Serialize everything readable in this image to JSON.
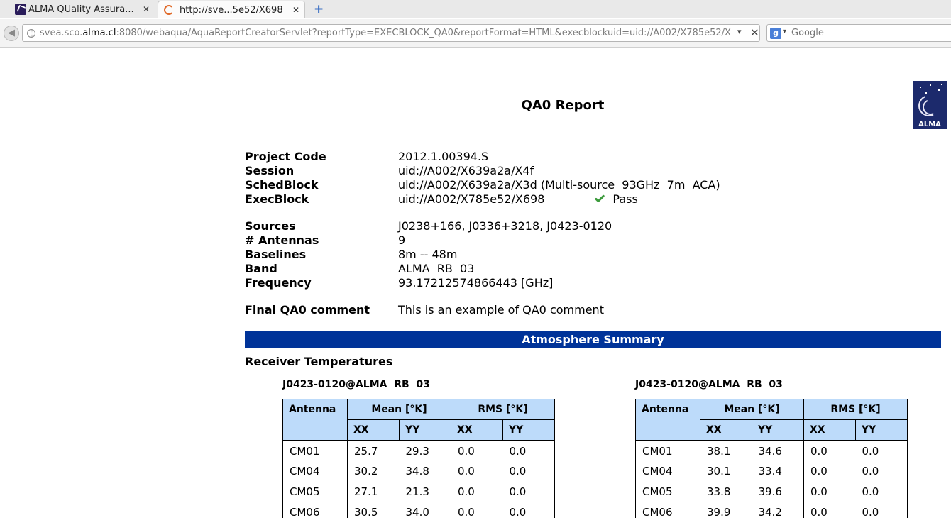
{
  "browser": {
    "tabs": [
      {
        "title": "ALMA QUality Assura...",
        "active": false
      },
      {
        "title": "http://sve...5e52/X698",
        "active": true
      }
    ],
    "new_tab_symbol": "+",
    "url_prefix": "svea.sco.",
    "url_domain": "alma.cl",
    "url_suffix": ":8080/webaqua/AquaReportCreatorServlet?reportType=EXECBLOCK_QA0&reportFormat=HTML&execblockuid=uid://A002/X785e52/X",
    "search_engine_icon": "google-icon",
    "search_placeholder": "Google"
  },
  "report": {
    "title": "QA0 Report",
    "logo_text": "ALMA",
    "fields_primary": [
      {
        "label": "Project Code",
        "value": "2012.1.00394.S"
      },
      {
        "label": "Session",
        "value": "uid://A002/X639a2a/X4f"
      },
      {
        "label": "SchedBlock",
        "value": "uid://A002/X639a2a/X3d (Multi-source  93GHz  7m  ACA)"
      },
      {
        "label": "ExecBlock",
        "value": "uid://A002/X785e52/X698"
      }
    ],
    "status": {
      "label": "Pass",
      "icon": "check-icon",
      "color": "#3d9b3d"
    },
    "fields_secondary": [
      {
        "label": "Sources",
        "value": "J0238+166, J0336+3218, J0423-0120"
      },
      {
        "label": "# Antennas",
        "value": "9"
      },
      {
        "label": "Baselines",
        "value": "8m -- 48m"
      },
      {
        "label": "Band",
        "value": "ALMA  RB  03"
      },
      {
        "label": "Frequency",
        "value": "93.17212574866443 [GHz]"
      }
    ],
    "comment": {
      "label": "Final QA0 comment",
      "value": "This is an example of QA0 comment"
    },
    "section_title": "Atmosphere Summary",
    "section_color": "#003399",
    "subsection_title": "Receiver Temperatures",
    "table_header_color": "#bddbfa",
    "table_headers": {
      "antenna": "Antenna",
      "mean": "Mean [°K]",
      "rms": "RMS [°K]",
      "xx": "XX",
      "yy": "YY"
    },
    "tables": [
      {
        "caption": "J0423-0120@ALMA  RB  03",
        "rows": [
          {
            "antenna": "CM01",
            "mean_xx": "25.7",
            "mean_yy": "29.3",
            "rms_xx": "0.0",
            "rms_yy": "0.0"
          },
          {
            "antenna": "CM04",
            "mean_xx": "30.2",
            "mean_yy": "34.8",
            "rms_xx": "0.0",
            "rms_yy": "0.0"
          },
          {
            "antenna": "CM05",
            "mean_xx": "27.1",
            "mean_yy": "21.3",
            "rms_xx": "0.0",
            "rms_yy": "0.0"
          },
          {
            "antenna": "CM06",
            "mean_xx": "30.5",
            "mean_yy": "34.0",
            "rms_xx": "0.0",
            "rms_yy": "0.0"
          }
        ]
      },
      {
        "caption": "J0423-0120@ALMA  RB  03",
        "rows": [
          {
            "antenna": "CM01",
            "mean_xx": "38.1",
            "mean_yy": "34.6",
            "rms_xx": "0.0",
            "rms_yy": "0.0"
          },
          {
            "antenna": "CM04",
            "mean_xx": "30.1",
            "mean_yy": "33.4",
            "rms_xx": "0.0",
            "rms_yy": "0.0"
          },
          {
            "antenna": "CM05",
            "mean_xx": "33.8",
            "mean_yy": "39.6",
            "rms_xx": "0.0",
            "rms_yy": "0.0"
          },
          {
            "antenna": "CM06",
            "mean_xx": "39.9",
            "mean_yy": "34.2",
            "rms_xx": "0.0",
            "rms_yy": "0.0"
          }
        ]
      }
    ]
  }
}
